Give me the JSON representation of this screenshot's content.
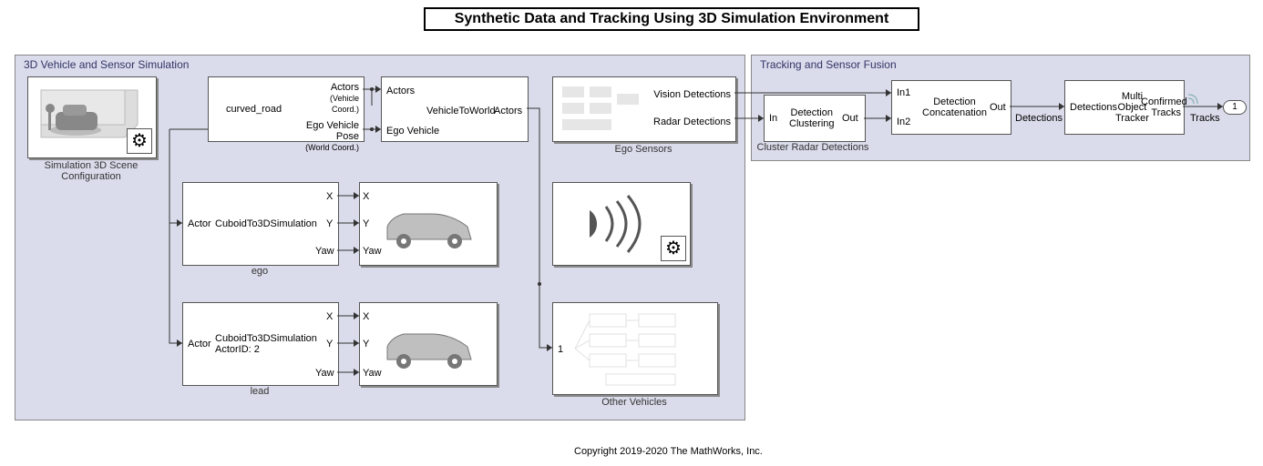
{
  "title": "Synthetic Data and Tracking Using 3D Simulation Environment",
  "copyright": "Copyright 2019-2020 The MathWorks, Inc.",
  "subs": {
    "left": {
      "label": "3D Vehicle and Sensor Simulation"
    },
    "right": {
      "label": "Tracking and Sensor Fusion"
    }
  },
  "blocks": {
    "scene": {
      "label": "Simulation 3D Scene Configuration"
    },
    "scenario": {
      "p1a": "Actors",
      "p1b": "(Vehicle Coord.)",
      "p2": "curved_road",
      "p3a": "Ego Vehicle Pose",
      "p3b": "(World Coord.)"
    },
    "v2w": {
      "name": "VehicleToWorld",
      "in1": "Actors",
      "in2": "Ego Vehicle",
      "out": "Actors"
    },
    "ego": {
      "name": "CuboidTo3DSimulation",
      "in": "Actor",
      "o1": "X",
      "o2": "Y",
      "o3": "Yaw",
      "label": "ego"
    },
    "lead": {
      "name": "CuboidTo3DSimulation",
      "sub": "ActorID: 2",
      "in": "Actor",
      "o1": "X",
      "o2": "Y",
      "o3": "Yaw",
      "label": "lead"
    },
    "veh1": {
      "i1": "X",
      "i2": "Y",
      "i3": "Yaw"
    },
    "veh2": {
      "i1": "X",
      "i2": "Y",
      "i3": "Yaw"
    },
    "sensors": {
      "label": "Ego Sensors",
      "o1": "Vision Detections",
      "o2": "Radar Detections"
    },
    "other": {
      "label": "Other Vehicles",
      "in": "1"
    },
    "cluster": {
      "in": "In",
      "name": "Detection\nClustering",
      "out": "Out",
      "label": "Cluster Radar Detections"
    },
    "concat": {
      "i1": "In1",
      "i2": "In2",
      "name": "Detection\nConcatenation",
      "out": "Out"
    },
    "tracker": {
      "in": "Detections",
      "name": "Multi\nObject\nTracker",
      "out": "Confirmed\nTracks"
    },
    "outport": {
      "val": "1",
      "label": "Tracks"
    }
  },
  "sig": {
    "detections": "Detections"
  }
}
